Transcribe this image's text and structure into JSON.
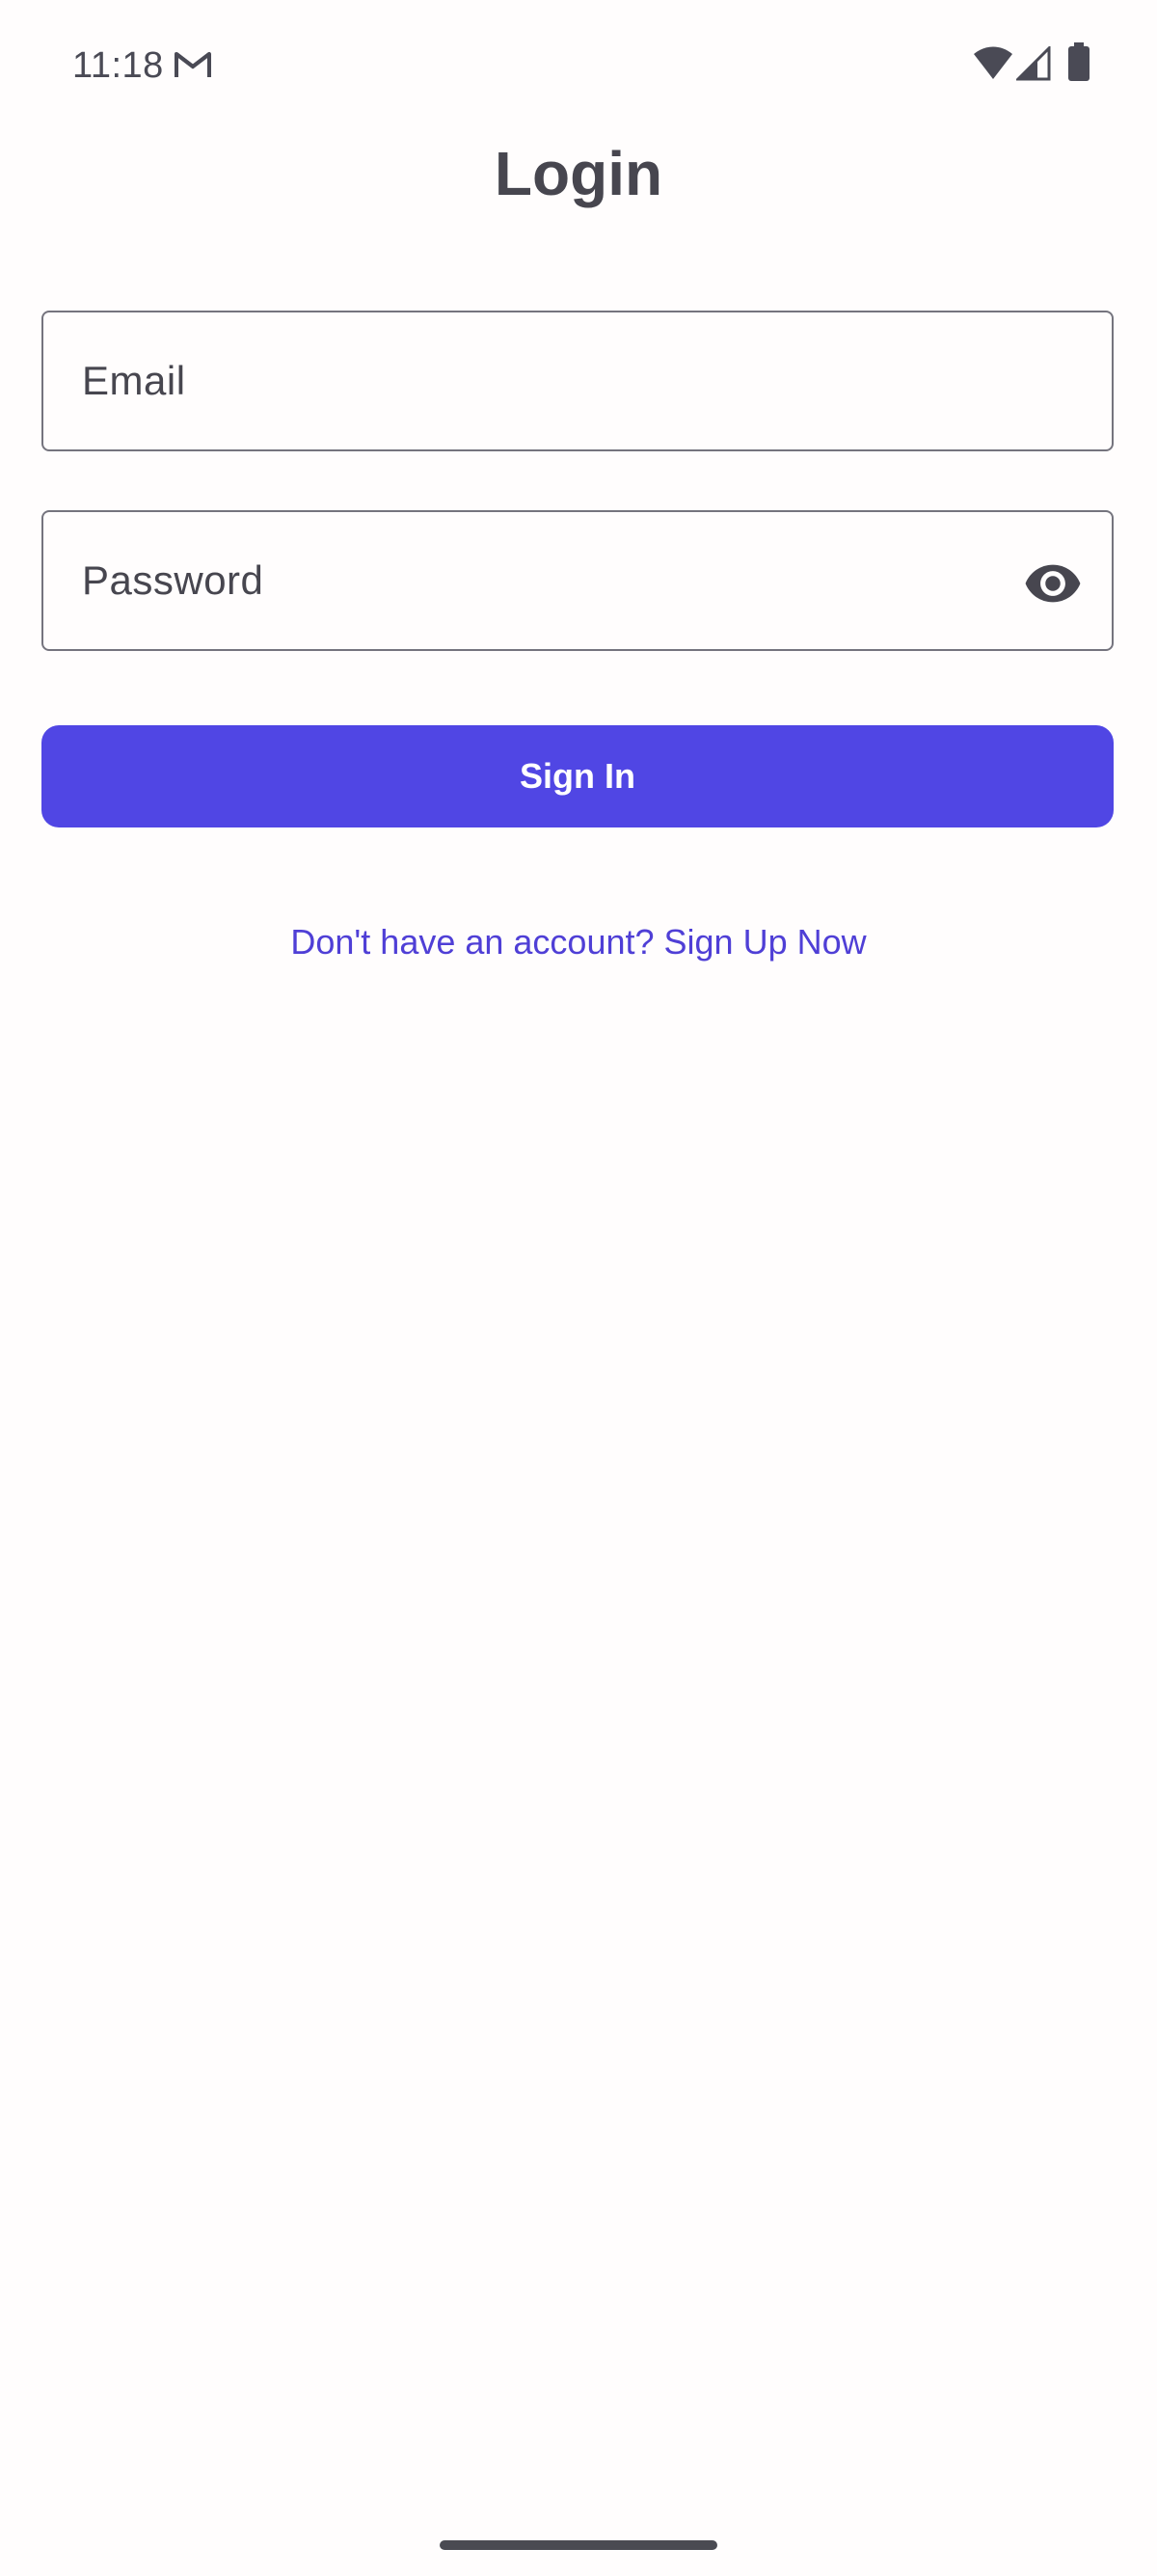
{
  "status_bar": {
    "time": "11:18",
    "notification_icon": "gmail-icon",
    "icons": [
      "wifi-icon",
      "cellular-signal-icon",
      "battery-icon"
    ]
  },
  "page": {
    "title": "Login"
  },
  "form": {
    "email": {
      "placeholder": "Email",
      "value": ""
    },
    "password": {
      "placeholder": "Password",
      "value": "",
      "toggle_icon": "eye-icon"
    },
    "sign_in_label": "Sign In",
    "signup_link": "Don't have an account? Sign Up Now"
  },
  "colors": {
    "primary": "#5046e4",
    "link": "#4f3fd6",
    "text": "#47464f",
    "outline": "#75747e",
    "background": "#fffdfd"
  }
}
